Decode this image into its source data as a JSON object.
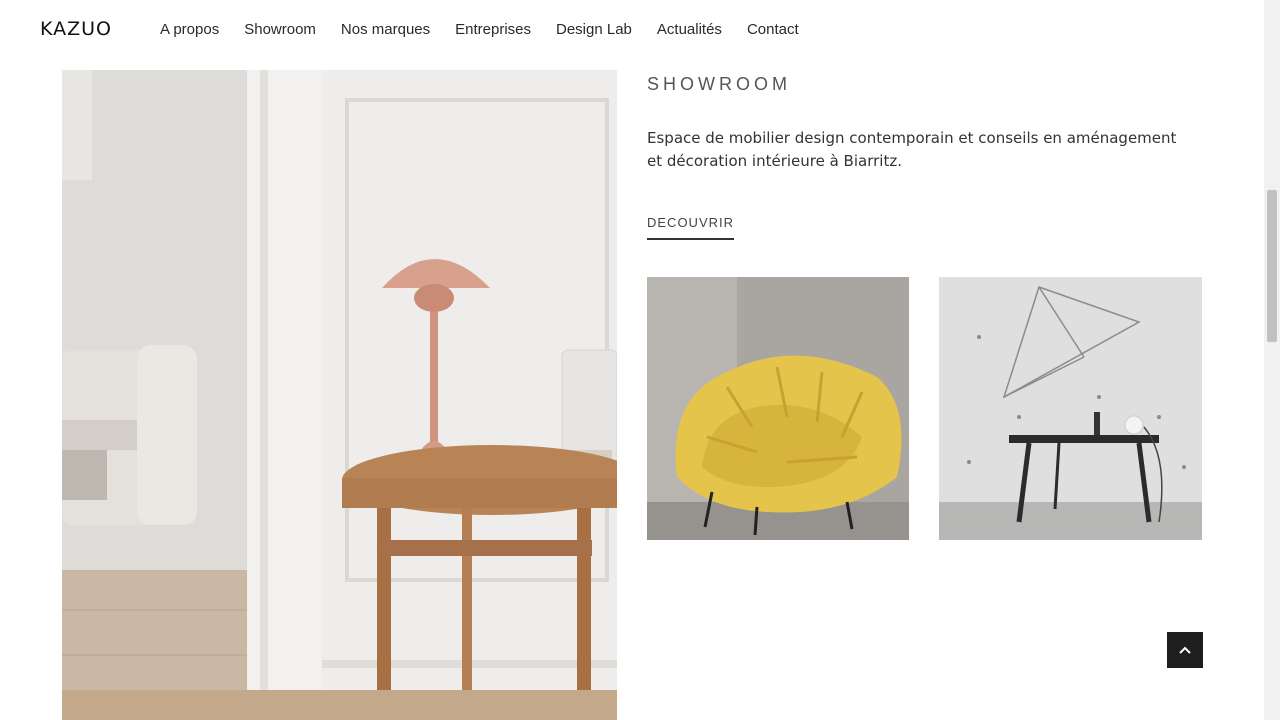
{
  "header": {
    "logo": "KAZUO",
    "nav": [
      "A propos",
      "Showroom",
      "Nos marques",
      "Entreprises",
      "Design Lab",
      "Actualités",
      "Contact"
    ]
  },
  "section": {
    "title": "SHOWROOM",
    "description": "Espace de mobilier design contemporain et conseils en aménagement et décoration intérieure à Biarritz.",
    "cta": "DECOUVRIR"
  },
  "icons": {
    "back_to_top": "chevron-up-icon"
  },
  "colors": {
    "accent": "#1e1e1e",
    "text": "#333333"
  }
}
